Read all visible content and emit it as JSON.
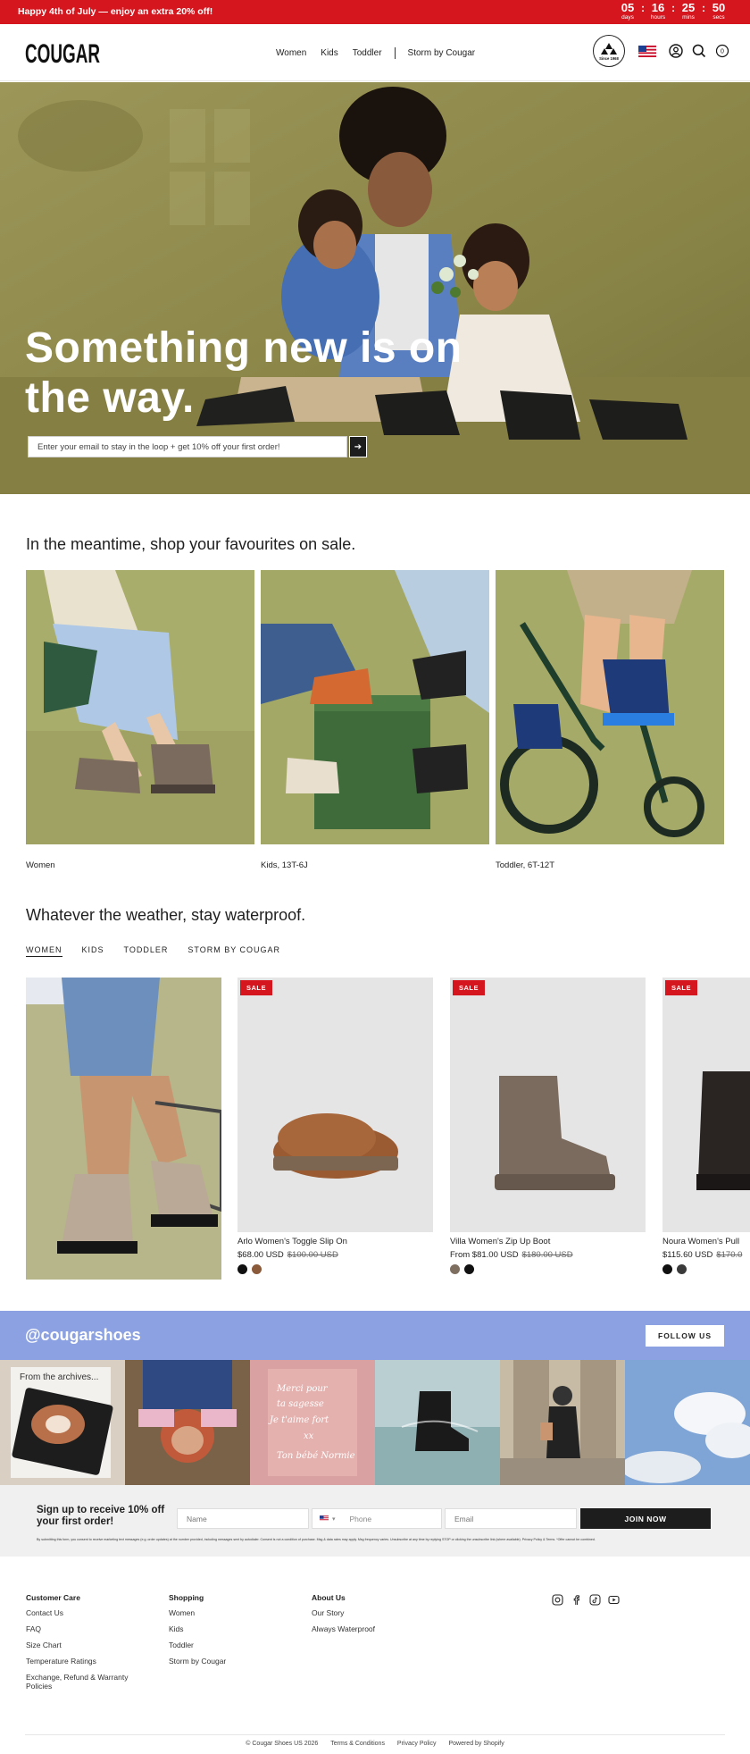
{
  "announcement": {
    "message": "Happy 4th of July — enjoy an extra 20% off!",
    "countdown": [
      {
        "value": "05",
        "label": "days"
      },
      {
        "value": "16",
        "label": "hours"
      },
      {
        "value": "25",
        "label": "mins"
      },
      {
        "value": "50",
        "label": "secs"
      }
    ],
    "separator": ":"
  },
  "header": {
    "logo": "COUGAR",
    "nav": [
      "Women",
      "Kids",
      "Toddler",
      "Storm by Cougar"
    ],
    "badge": "Since 1968",
    "icons": [
      "us-flag-icon",
      "account-icon",
      "search-icon",
      "cart-icon"
    ],
    "cart_count": "0"
  },
  "hero": {
    "title": "Something new is on the way.",
    "email_placeholder": "Enter your email to stay in the loop + get 10% off your first order!",
    "submit_label": "➔"
  },
  "sale_section": {
    "title": "In the meantime, shop your favourites on sale.",
    "categories": [
      "Women",
      "Kids, 13T-6J",
      "Toddler, 6T-12T"
    ]
  },
  "waterproof_section": {
    "title": "Whatever the weather, stay waterproof.",
    "tabs": [
      "WOMEN",
      "KIDS",
      "TODDLER",
      "STORM BY COUGAR"
    ],
    "active_tab": "WOMEN",
    "products": [
      {
        "badge": "SALE",
        "name": "Arlo Women's Toggle Slip On",
        "price": "$68.00 USD",
        "compare_price": "$100.00 USD",
        "swatches": [
          "#111111",
          "#8a5a3a"
        ]
      },
      {
        "badge": "SALE",
        "name": "Villa Women's Zip Up Boot",
        "price": "From $81.00 USD",
        "compare_price": "$180.00 USD",
        "swatches": [
          "#7d6e60",
          "#111111"
        ]
      },
      {
        "badge": "SALE",
        "name": "Noura Women's Pull",
        "price": "$115.60 USD",
        "compare_price": "$170.0",
        "swatches": [
          "#111111",
          "#3a3a3a"
        ]
      }
    ]
  },
  "instagram": {
    "handle": "@cougarshoes",
    "follow_label": "FOLLOW US",
    "archive_caption": "From the archives...",
    "note_lines": [
      "Merci pour",
      "ta sagesse",
      "Je t'aime fort",
      "xx",
      "Ton bébé Normie"
    ]
  },
  "newsletter": {
    "title": "Sign up to receive 10% off your first order!",
    "name_placeholder": "Name",
    "phone_placeholder": "Phone",
    "email_placeholder": "Email",
    "join_label": "JOIN NOW",
    "fine_print": "By submitting this form, you consent to receive marketing text messages (e.g. order updates) at the number provided, including messages sent by autodialer. Consent is not a condition of purchase. Msg & data rates may apply. Msg frequency varies. Unsubscribe at any time by replying STOP or clicking the unsubscribe link (where available). Privacy Policy & Terms. *Offer cannot be combined."
  },
  "footer": {
    "columns": [
      {
        "title": "Customer Care",
        "links": [
          "Contact Us",
          "FAQ",
          "Size Chart",
          "Temperature Ratings",
          "Exchange, Refund & Warranty Policies"
        ]
      },
      {
        "title": "Shopping",
        "links": [
          "Women",
          "Kids",
          "Toddler",
          "Storm by Cougar"
        ]
      },
      {
        "title": "About Us",
        "links": [
          "Our Story",
          "Always Waterproof"
        ]
      }
    ],
    "social_icons": [
      "instagram-icon",
      "facebook-icon",
      "tiktok-icon",
      "youtube-icon"
    ],
    "bottom": [
      "© Cougar Shoes US 2026",
      "Terms & Conditions",
      "Privacy Policy",
      "Powered by Shopify"
    ]
  },
  "colors": {
    "brand_red": "#d5161e",
    "social_blue": "#8ca1e1",
    "hero_olive": "#8f8a4d",
    "dark": "#1d1d1d"
  }
}
